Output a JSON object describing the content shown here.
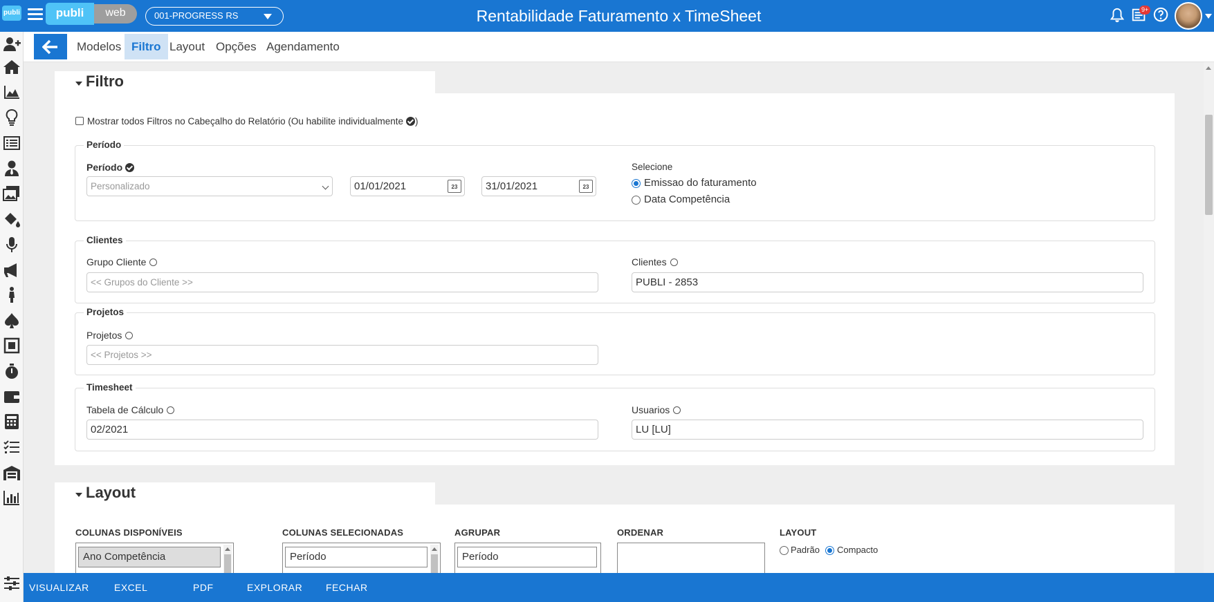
{
  "app": {
    "title": "Rentabilidade Faturamento x TimeSheet",
    "logo_left": "publi",
    "logo_right": "web",
    "side_logo": "publi",
    "company": "001-PROGRESS RS",
    "notifications_badge": "9+"
  },
  "tabs": [
    {
      "label": "Modelos"
    },
    {
      "label": "Filtro",
      "active": true
    },
    {
      "label": "Layout"
    },
    {
      "label": "Opções"
    },
    {
      "label": "Agendamento"
    }
  ],
  "filtro": {
    "title": "Filtro",
    "show_all_label": "Mostrar todos Filtros no Cabeçalho do Relatório",
    "show_all_hint_open": "(Ou habilite individualmente",
    "show_all_hint_close": ")",
    "periodo_section": {
      "legend": "Período",
      "label": "Período",
      "select_value": "Personalizado",
      "date_from": "01/01/2021",
      "date_to": "31/01/2021",
      "calendar_day": "23",
      "selecione_label": "Selecione",
      "option_emissao": "Emissao do faturamento",
      "option_competencia": "Data Competência"
    },
    "clientes_section": {
      "legend": "Clientes",
      "grupo_label": "Grupo Cliente",
      "grupo_placeholder": "<< Grupos do Cliente >>",
      "clientes_label": "Clientes",
      "clientes_value": "PUBLI - 2853"
    },
    "projetos_section": {
      "legend": "Projetos",
      "label": "Projetos",
      "placeholder": "<< Projetos >>"
    },
    "timesheet_section": {
      "legend": "Timesheet",
      "tabela_label": "Tabela de Cálculo",
      "tabela_value": "02/2021",
      "usuarios_label": "Usuarios",
      "usuarios_value": "LU [LU]"
    }
  },
  "layout_section": {
    "title": "Layout",
    "col_disponiveis": "COLUNAS DISPONÍVEIS",
    "col_selecionadas": "COLUNAS SELECIONADAS",
    "agrupar": "AGRUPAR",
    "ordenar": "ORDENAR",
    "layout": "LAYOUT",
    "disponiveis_first": "Ano Competência",
    "selecionadas_first": "Período",
    "agrupar_first": "Período",
    "opt_padrao": "Padrão",
    "opt_compacto": "Compacto"
  },
  "bottom": {
    "visualizar": "VISUALIZAR",
    "excel": "EXCEL",
    "pdf": "PDF",
    "explorar": "EXPLORAR",
    "fechar": "FECHAR"
  },
  "colors": {
    "primary": "#1976d2",
    "tab_active_bg": "#cfe2f5",
    "page_bg": "#eeeeee"
  },
  "sidebar_icons": [
    "add-user-icon",
    "home-icon",
    "area-chart-icon",
    "lightbulb-icon",
    "list-icon",
    "user-tie-icon",
    "images-icon",
    "paint-bucket-icon",
    "microphone-icon",
    "megaphone-icon",
    "person-icon",
    "spade-icon",
    "stop-square-icon",
    "stopwatch-icon",
    "wallet-icon",
    "calculator-icon",
    "checklist-icon",
    "warehouse-icon",
    "bar-chart-icon",
    "sliders-icon"
  ]
}
